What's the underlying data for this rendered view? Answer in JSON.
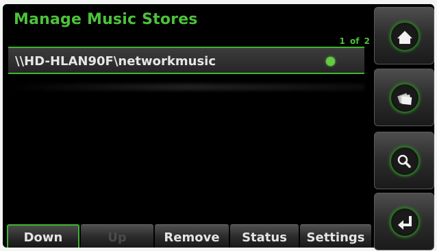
{
  "header": {
    "title": "Manage Music Stores",
    "page_counter": "1 of 2"
  },
  "list": {
    "items": [
      {
        "label": "\\\\HD-HLAN90F\\networkmusic",
        "status": "online"
      }
    ]
  },
  "bottom_bar": {
    "down_label": "Down",
    "up_label": "Up",
    "remove_label": "Remove",
    "status_label": "Status",
    "settings_label": "Settings"
  },
  "side_buttons": [
    "home-icon",
    "cards-icon",
    "search-icon",
    "return-icon"
  ],
  "colors": {
    "accent": "#4cc23a",
    "background": "#000000",
    "status_dot": "#62cc3f"
  }
}
